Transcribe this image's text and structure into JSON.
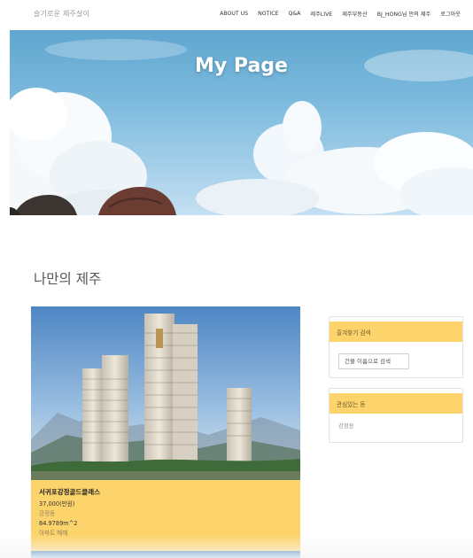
{
  "navbar": {
    "brand": "슬기로운 제주살이",
    "links": [
      "ABOUT US",
      "NOTICE",
      "Q&A",
      "제주LIVE",
      "제주부동산",
      "BJ_HONG님 만의 제주",
      "로그아웃"
    ]
  },
  "hero": {
    "title": "My Page"
  },
  "section": {
    "title": "나만의 제주"
  },
  "listing": {
    "name": "서귀포강정골드클래스",
    "price": "37,000(만원)",
    "area_name": "강정동",
    "size": "84.9789m^2",
    "type": "아파트 매매"
  },
  "sidebar": {
    "search_panel": {
      "title": "즐겨찾기 검색",
      "placeholder": "건물 이름으로 검색"
    },
    "interest_panel": {
      "title": "관심있는 동",
      "items": [
        "강정동"
      ]
    }
  },
  "colors": {
    "accent": "#fdd46c",
    "panel_border": "#e3e3e3",
    "hero_sky": "#7ebbde"
  }
}
